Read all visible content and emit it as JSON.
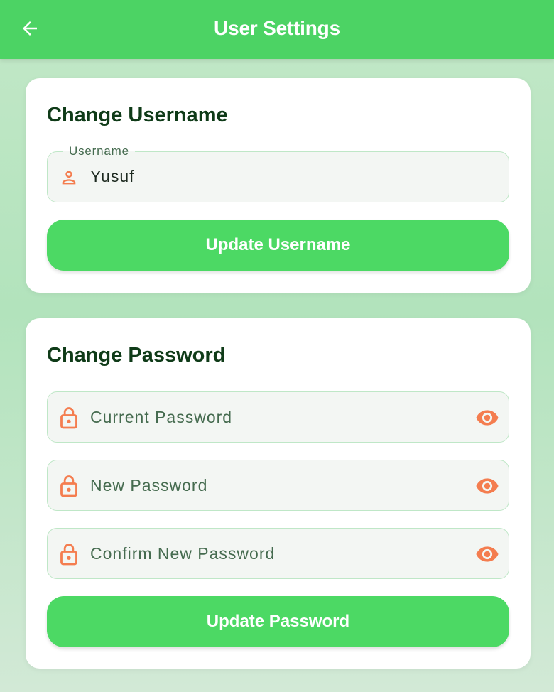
{
  "appbar": {
    "title": "User Settings",
    "back_icon": "arrow-left-icon"
  },
  "colors": {
    "appbar": "#4cd364",
    "button": "#4cd964",
    "accent_icon": "#f47d4f",
    "title_text": "#0f3b18"
  },
  "username_card": {
    "title": "Change Username",
    "field": {
      "label": "Username",
      "value": "Yusuf",
      "icon": "person-icon"
    },
    "button_label": "Update Username"
  },
  "password_card": {
    "title": "Change Password",
    "fields": [
      {
        "placeholder": "Current Password",
        "icon": "lock-icon",
        "toggle_icon": "eye-icon"
      },
      {
        "placeholder": "New Password",
        "icon": "lock-icon",
        "toggle_icon": "eye-icon"
      },
      {
        "placeholder": "Confirm New Password",
        "icon": "lock-icon",
        "toggle_icon": "eye-icon"
      }
    ],
    "button_label": "Update Password"
  }
}
